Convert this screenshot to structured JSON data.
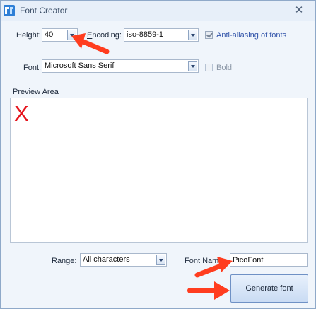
{
  "window": {
    "title": "Font Creator",
    "close_glyph": "✕",
    "icon": "font-creator-app-icon"
  },
  "settings": {
    "height_label": "Height:",
    "height_value": "40",
    "encoding_label_first": "E",
    "encoding_label_rest": "ncoding:",
    "encoding_value": "iso-8859-1",
    "antialias_label": "Anti-aliasing of fonts",
    "antialias_checked": true,
    "font_label": "Font:",
    "font_value": "Microsoft Sans Serif",
    "bold_label": "Bold",
    "bold_checked": false
  },
  "preview": {
    "label": "Preview Area",
    "glyph": "X",
    "glyph_color": "#e6141c"
  },
  "footer": {
    "range_label": "Range:",
    "range_value": "All characters",
    "font_name_label": "Font Name:",
    "font_name_value": "PicoFont",
    "generate_label": "Generate font"
  },
  "annotations": {
    "arrow_color": "#ff3d1f",
    "arrow_icon": "red-pointer-arrow-icon"
  }
}
